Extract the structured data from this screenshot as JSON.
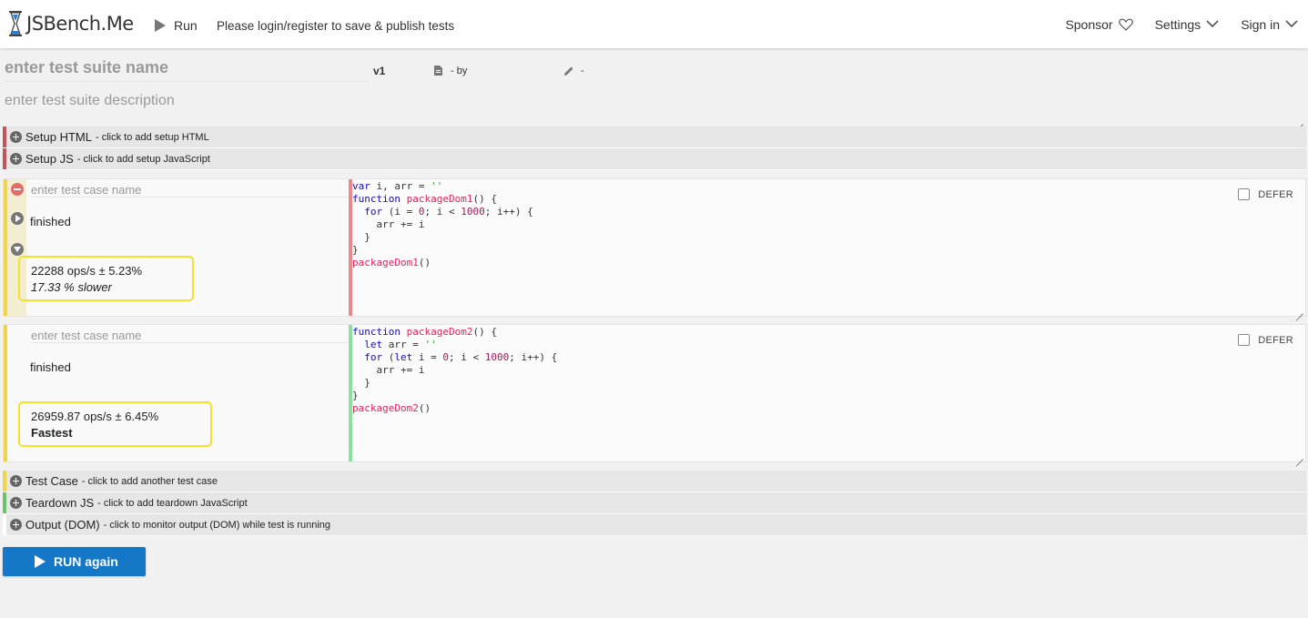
{
  "header": {
    "logo_text": "JSBench.Me",
    "run_label": "Run",
    "login_note": "Please login/register to save & publish tests",
    "nav": {
      "sponsor_label": "Sponsor",
      "settings_label": "Settings",
      "signin_label": "Sign in"
    }
  },
  "suite": {
    "name_placeholder": "enter test suite name",
    "version": "v1",
    "by_label": "- by",
    "edited_label": "-",
    "description_placeholder": "enter test suite description"
  },
  "sections": {
    "setup_html": {
      "title": "Setup HTML",
      "hint": "- click to add setup HTML"
    },
    "setup_js": {
      "title": "Setup JS",
      "hint": "- click to add setup JavaScript"
    },
    "add_test_case": {
      "title": "Test Case",
      "hint": "- click to add another test case"
    },
    "teardown_js": {
      "title": "Teardown JS",
      "hint": "- click to add teardown JavaScript"
    },
    "output_dom": {
      "title": "Output (DOM)",
      "hint": "- click to monitor output (DOM) while test is running"
    }
  },
  "test_cases": [
    {
      "name_placeholder": "enter test case name",
      "status": "finished",
      "ops": "22288 ops/s ± 5.23%",
      "comparison": "17.33 % slower",
      "defer_label": "DEFER",
      "code": [
        "var i, arr = ''",
        "function packageDom1() {",
        "  for (i = 0; i < 1000; i++) {",
        "    arr += i",
        "  }",
        "}",
        "packageDom1()"
      ]
    },
    {
      "name_placeholder": "enter test case name",
      "status": "finished",
      "ops": "26959.87 ops/s ± 6.45%",
      "comparison": "Fastest",
      "defer_label": "DEFER",
      "code": [
        "function packageDom2() {",
        "  let arr = ''",
        "  for (let i = 0; i < 1000; i++) {",
        "    arr += i",
        "  }",
        "}",
        "packageDom2()"
      ]
    }
  ],
  "run_again_label": "RUN again",
  "colors": {
    "primary_button": "#1577c7",
    "highlight_box": "#f4e12a",
    "setup_html_accent": "#c0565b",
    "testcase_accent": "#f0d54a",
    "teardown_accent": "#6bc46b",
    "slower_code_bar": "#e88a8a",
    "fastest_code_bar": "#8ee0a0"
  }
}
